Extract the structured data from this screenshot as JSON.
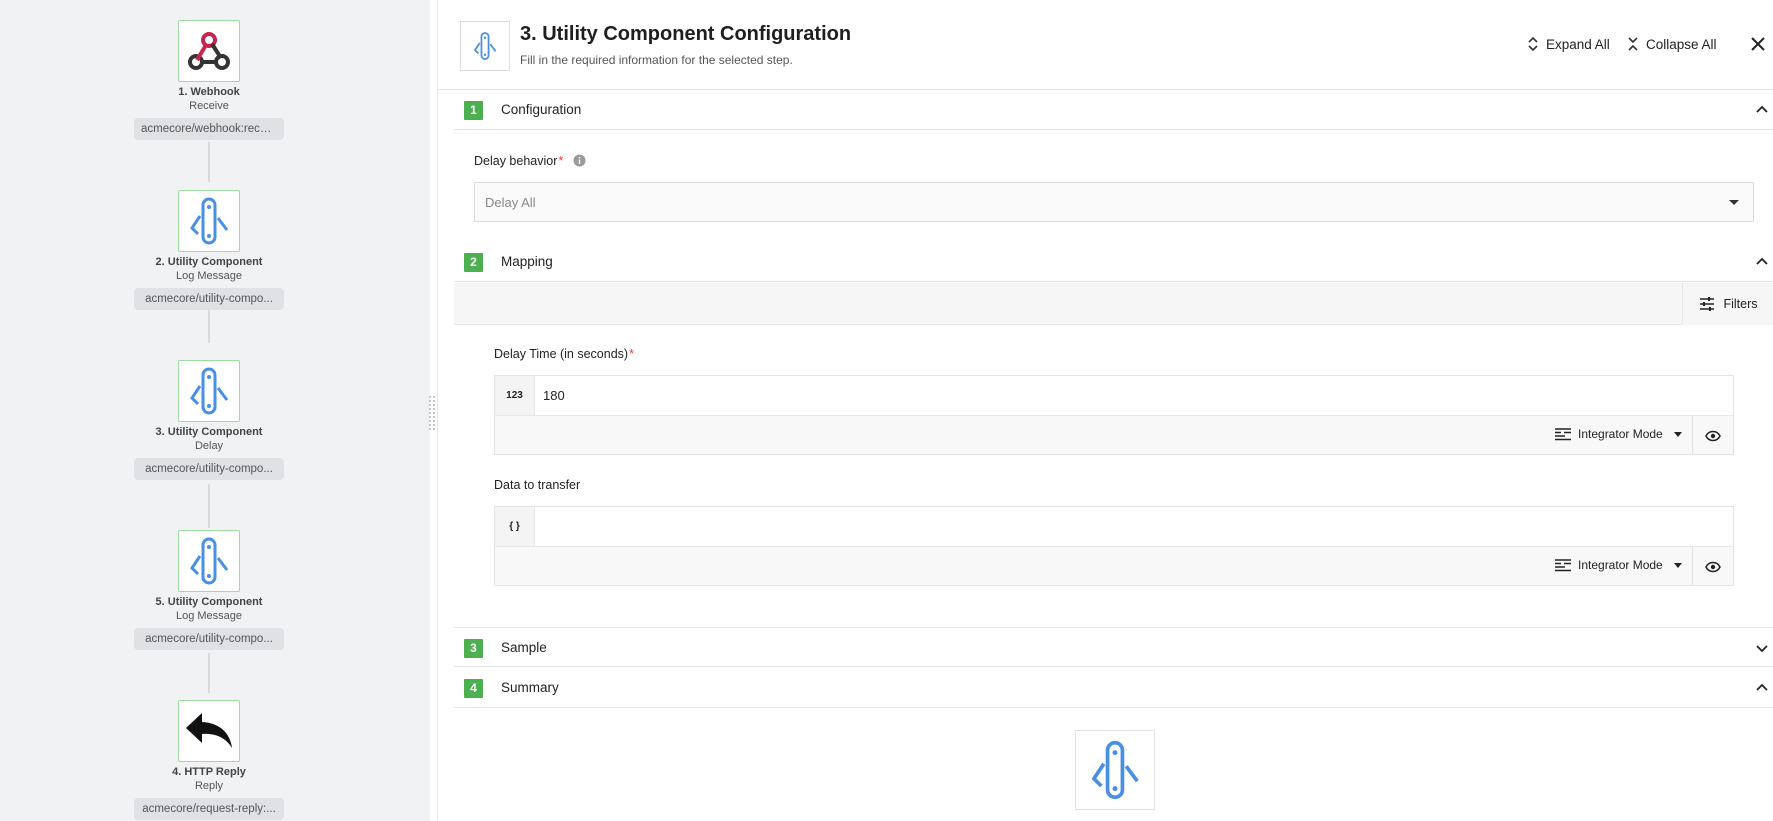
{
  "flow": {
    "steps": [
      {
        "name": "1. Webhook",
        "action": "Receive",
        "component": "acmecore/webhook:recei...",
        "icon": "webhook-icon"
      },
      {
        "name": "2. Utility Component",
        "action": "Log Message",
        "component": "acmecore/utility-compo...",
        "icon": "utility-icon"
      },
      {
        "name": "3. Utility Component",
        "action": "Delay",
        "component": "acmecore/utility-compo...",
        "icon": "utility-icon"
      },
      {
        "name": "5. Utility Component",
        "action": "Log Message",
        "component": "acmecore/utility-compo...",
        "icon": "utility-icon"
      },
      {
        "name": "4. HTTP Reply",
        "action": "Reply",
        "component": "acmecore/request-reply:...",
        "icon": "reply-arrow-icon"
      }
    ]
  },
  "header": {
    "title": "3. Utility Component Configuration",
    "subtitle": "Fill in the required information for the selected step.",
    "expand_all": "Expand All",
    "collapse_all": "Collapse All"
  },
  "sections": {
    "configuration": {
      "num": "1",
      "title": "Configuration"
    },
    "mapping": {
      "num": "2",
      "title": "Mapping"
    },
    "sample": {
      "num": "3",
      "title": "Sample"
    },
    "summary": {
      "num": "4",
      "title": "Summary"
    }
  },
  "configuration": {
    "delay_behavior_label": "Delay behavior",
    "required_mark": "*",
    "delay_behavior_value": "Delay All"
  },
  "mapping": {
    "filters_label": "Filters",
    "delay_time": {
      "label": "Delay Time (in seconds)",
      "type_badge": "123",
      "value": "180",
      "mode": "Integrator Mode"
    },
    "data_transfer": {
      "label": "Data to transfer",
      "type_badge": "{ }",
      "value": "",
      "mode": "Integrator Mode"
    }
  },
  "colors": {
    "step_number_badge": "#4caf50",
    "utility_icon_blue": "#4a90e2",
    "webhook_pink": "#c7254e",
    "required_star": "#e53935"
  }
}
